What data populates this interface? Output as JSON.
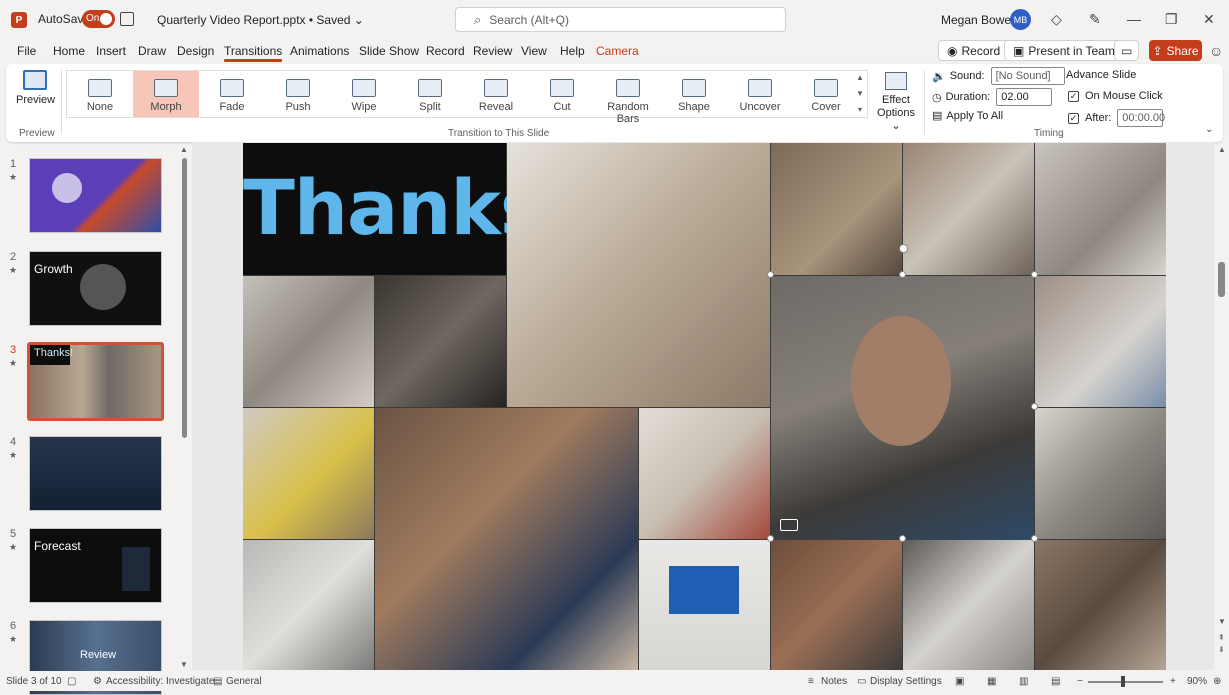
{
  "titlebar": {
    "autosave_label": "AutoSave",
    "autosave_state": "On",
    "doc_title": "Quarterly Video Report.pptx • Saved ⌄",
    "search_placeholder": "Search (Alt+Q)",
    "user_name": "Megan Bowen",
    "user_initials": "MB"
  },
  "menu": {
    "items": [
      "File",
      "Home",
      "Insert",
      "Draw",
      "Design",
      "Transitions",
      "Animations",
      "Slide Show",
      "Record",
      "Review",
      "View",
      "Help",
      "Camera"
    ],
    "record_btn": "Record",
    "teams_btn": "Present in Teams",
    "share_btn": "Share"
  },
  "ribbon": {
    "preview_label": "Preview",
    "preview_group": "Preview",
    "transitions": [
      "None",
      "Morph",
      "Fade",
      "Push",
      "Wipe",
      "Split",
      "Reveal",
      "Cut",
      "Random Bars",
      "Shape",
      "Uncover",
      "Cover"
    ],
    "selected_transition": "Morph",
    "gallery_group": "Transition to This Slide",
    "effect_options": "Effect Options ⌄",
    "sound_label": "Sound:",
    "sound_value": "[No Sound]",
    "duration_label": "Duration:",
    "duration_value": "02.00",
    "apply_all": "Apply To All",
    "advance_label": "Advance Slide",
    "on_mouse_click": "On Mouse Click",
    "after_label": "After:",
    "after_value": "00:00.00",
    "timing_group": "Timing"
  },
  "slides": [
    {
      "num": "1",
      "text": "",
      "color": "#5a3fb8"
    },
    {
      "num": "2",
      "text": "Growth",
      "color": "#101010"
    },
    {
      "num": "3",
      "text": "Thanks!",
      "color": "#6d5a4a"
    },
    {
      "num": "4",
      "text": "",
      "color": "#1c2b3e"
    },
    {
      "num": "5",
      "text": "Forecast",
      "color": "#0d0d0d"
    },
    {
      "num": "6",
      "text": "Review",
      "color": "#3b4f6a"
    }
  ],
  "slide": {
    "title": "Thanks!"
  },
  "status": {
    "slide_info": "Slide 3 of 10",
    "accessibility": "Accessibility: Investigate",
    "general": "General",
    "notes": "Notes",
    "display_settings": "Display Settings",
    "zoom": "90%"
  },
  "colors": {
    "accent": "#c43e1c",
    "thanks_text": "#5fb6ea"
  }
}
